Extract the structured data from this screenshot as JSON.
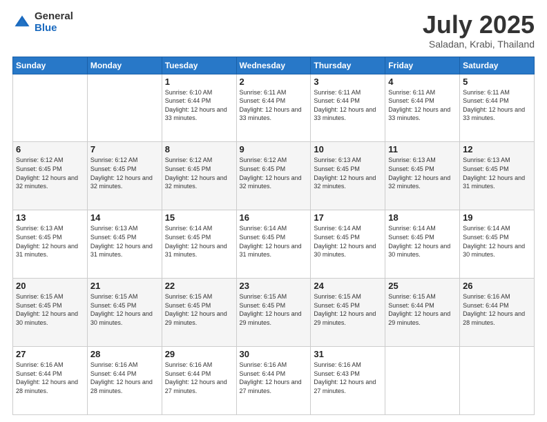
{
  "logo": {
    "general": "General",
    "blue": "Blue"
  },
  "header": {
    "month": "July 2025",
    "location": "Saladan, Krabi, Thailand"
  },
  "days_of_week": [
    "Sunday",
    "Monday",
    "Tuesday",
    "Wednesday",
    "Thursday",
    "Friday",
    "Saturday"
  ],
  "weeks": [
    [
      {
        "day": "",
        "sunrise": "",
        "sunset": "",
        "daylight": ""
      },
      {
        "day": "",
        "sunrise": "",
        "sunset": "",
        "daylight": ""
      },
      {
        "day": "1",
        "sunrise": "Sunrise: 6:10 AM",
        "sunset": "Sunset: 6:44 PM",
        "daylight": "Daylight: 12 hours and 33 minutes."
      },
      {
        "day": "2",
        "sunrise": "Sunrise: 6:11 AM",
        "sunset": "Sunset: 6:44 PM",
        "daylight": "Daylight: 12 hours and 33 minutes."
      },
      {
        "day": "3",
        "sunrise": "Sunrise: 6:11 AM",
        "sunset": "Sunset: 6:44 PM",
        "daylight": "Daylight: 12 hours and 33 minutes."
      },
      {
        "day": "4",
        "sunrise": "Sunrise: 6:11 AM",
        "sunset": "Sunset: 6:44 PM",
        "daylight": "Daylight: 12 hours and 33 minutes."
      },
      {
        "day": "5",
        "sunrise": "Sunrise: 6:11 AM",
        "sunset": "Sunset: 6:44 PM",
        "daylight": "Daylight: 12 hours and 33 minutes."
      }
    ],
    [
      {
        "day": "6",
        "sunrise": "Sunrise: 6:12 AM",
        "sunset": "Sunset: 6:45 PM",
        "daylight": "Daylight: 12 hours and 32 minutes."
      },
      {
        "day": "7",
        "sunrise": "Sunrise: 6:12 AM",
        "sunset": "Sunset: 6:45 PM",
        "daylight": "Daylight: 12 hours and 32 minutes."
      },
      {
        "day": "8",
        "sunrise": "Sunrise: 6:12 AM",
        "sunset": "Sunset: 6:45 PM",
        "daylight": "Daylight: 12 hours and 32 minutes."
      },
      {
        "day": "9",
        "sunrise": "Sunrise: 6:12 AM",
        "sunset": "Sunset: 6:45 PM",
        "daylight": "Daylight: 12 hours and 32 minutes."
      },
      {
        "day": "10",
        "sunrise": "Sunrise: 6:13 AM",
        "sunset": "Sunset: 6:45 PM",
        "daylight": "Daylight: 12 hours and 32 minutes."
      },
      {
        "day": "11",
        "sunrise": "Sunrise: 6:13 AM",
        "sunset": "Sunset: 6:45 PM",
        "daylight": "Daylight: 12 hours and 32 minutes."
      },
      {
        "day": "12",
        "sunrise": "Sunrise: 6:13 AM",
        "sunset": "Sunset: 6:45 PM",
        "daylight": "Daylight: 12 hours and 31 minutes."
      }
    ],
    [
      {
        "day": "13",
        "sunrise": "Sunrise: 6:13 AM",
        "sunset": "Sunset: 6:45 PM",
        "daylight": "Daylight: 12 hours and 31 minutes."
      },
      {
        "day": "14",
        "sunrise": "Sunrise: 6:13 AM",
        "sunset": "Sunset: 6:45 PM",
        "daylight": "Daylight: 12 hours and 31 minutes."
      },
      {
        "day": "15",
        "sunrise": "Sunrise: 6:14 AM",
        "sunset": "Sunset: 6:45 PM",
        "daylight": "Daylight: 12 hours and 31 minutes."
      },
      {
        "day": "16",
        "sunrise": "Sunrise: 6:14 AM",
        "sunset": "Sunset: 6:45 PM",
        "daylight": "Daylight: 12 hours and 31 minutes."
      },
      {
        "day": "17",
        "sunrise": "Sunrise: 6:14 AM",
        "sunset": "Sunset: 6:45 PM",
        "daylight": "Daylight: 12 hours and 30 minutes."
      },
      {
        "day": "18",
        "sunrise": "Sunrise: 6:14 AM",
        "sunset": "Sunset: 6:45 PM",
        "daylight": "Daylight: 12 hours and 30 minutes."
      },
      {
        "day": "19",
        "sunrise": "Sunrise: 6:14 AM",
        "sunset": "Sunset: 6:45 PM",
        "daylight": "Daylight: 12 hours and 30 minutes."
      }
    ],
    [
      {
        "day": "20",
        "sunrise": "Sunrise: 6:15 AM",
        "sunset": "Sunset: 6:45 PM",
        "daylight": "Daylight: 12 hours and 30 minutes."
      },
      {
        "day": "21",
        "sunrise": "Sunrise: 6:15 AM",
        "sunset": "Sunset: 6:45 PM",
        "daylight": "Daylight: 12 hours and 30 minutes."
      },
      {
        "day": "22",
        "sunrise": "Sunrise: 6:15 AM",
        "sunset": "Sunset: 6:45 PM",
        "daylight": "Daylight: 12 hours and 29 minutes."
      },
      {
        "day": "23",
        "sunrise": "Sunrise: 6:15 AM",
        "sunset": "Sunset: 6:45 PM",
        "daylight": "Daylight: 12 hours and 29 minutes."
      },
      {
        "day": "24",
        "sunrise": "Sunrise: 6:15 AM",
        "sunset": "Sunset: 6:45 PM",
        "daylight": "Daylight: 12 hours and 29 minutes."
      },
      {
        "day": "25",
        "sunrise": "Sunrise: 6:15 AM",
        "sunset": "Sunset: 6:44 PM",
        "daylight": "Daylight: 12 hours and 29 minutes."
      },
      {
        "day": "26",
        "sunrise": "Sunrise: 6:16 AM",
        "sunset": "Sunset: 6:44 PM",
        "daylight": "Daylight: 12 hours and 28 minutes."
      }
    ],
    [
      {
        "day": "27",
        "sunrise": "Sunrise: 6:16 AM",
        "sunset": "Sunset: 6:44 PM",
        "daylight": "Daylight: 12 hours and 28 minutes."
      },
      {
        "day": "28",
        "sunrise": "Sunrise: 6:16 AM",
        "sunset": "Sunset: 6:44 PM",
        "daylight": "Daylight: 12 hours and 28 minutes."
      },
      {
        "day": "29",
        "sunrise": "Sunrise: 6:16 AM",
        "sunset": "Sunset: 6:44 PM",
        "daylight": "Daylight: 12 hours and 27 minutes."
      },
      {
        "day": "30",
        "sunrise": "Sunrise: 6:16 AM",
        "sunset": "Sunset: 6:44 PM",
        "daylight": "Daylight: 12 hours and 27 minutes."
      },
      {
        "day": "31",
        "sunrise": "Sunrise: 6:16 AM",
        "sunset": "Sunset: 6:43 PM",
        "daylight": "Daylight: 12 hours and 27 minutes."
      },
      {
        "day": "",
        "sunrise": "",
        "sunset": "",
        "daylight": ""
      },
      {
        "day": "",
        "sunrise": "",
        "sunset": "",
        "daylight": ""
      }
    ]
  ]
}
